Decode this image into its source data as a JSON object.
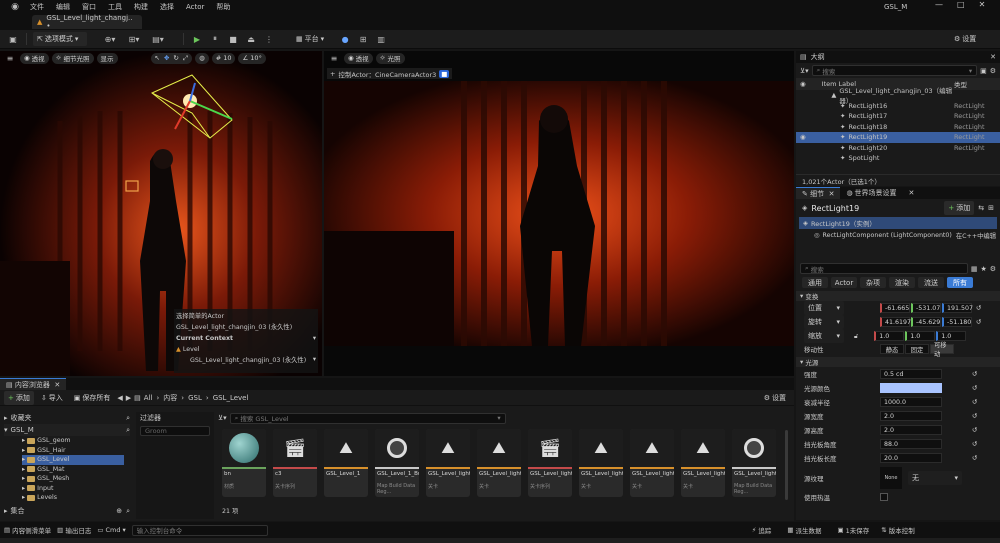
{
  "menu": {
    "file": "文件",
    "edit": "编辑",
    "window": "窗口",
    "tools": "工具",
    "build": "构建",
    "select": "选择",
    "actor": "Actor",
    "help": "帮助"
  },
  "window_title": "GSL_M",
  "doc_tab": "GSL_Level_light_changj.. •",
  "toolbar": {
    "mode": "选项模式",
    "platform": "平台",
    "settings": "设置"
  },
  "viewport_left": {
    "perspective": "透视",
    "lighting": "细节光照",
    "show": "显示",
    "grid": "10",
    "angle": "10°",
    "overlay_title": "选择简单的Actor",
    "overlay_actor": "GSL_Level_light_changjin_03 (永久性)",
    "current_context": "Current Context",
    "level_label": "Level",
    "level_value": "GSL_Level_light_changjin_03 (永久性)"
  },
  "viewport_right": {
    "perspective": "透视",
    "lighting": "光照",
    "pilot": "控制Actor：CineCameraActor3"
  },
  "outliner": {
    "title": "大纲",
    "search": "搜索",
    "col_label": "Item Label",
    "col_type": "类型",
    "rows": [
      {
        "label": "GSL_Level_light_changjin_03（编辑器）",
        "type": "",
        "indent": 1,
        "selected": false
      },
      {
        "label": "RectLight16",
        "type": "RectLight",
        "indent": 2,
        "selected": false
      },
      {
        "label": "RectLight17",
        "type": "RectLight",
        "indent": 2,
        "selected": false
      },
      {
        "label": "RectLight18",
        "type": "RectLight",
        "indent": 2,
        "selected": false
      },
      {
        "label": "RectLight19",
        "type": "RectLight",
        "indent": 2,
        "selected": true
      },
      {
        "label": "RectLight20",
        "type": "RectLight",
        "indent": 2,
        "selected": false
      },
      {
        "label": "SpotLight",
        "type": "",
        "indent": 2,
        "selected": false
      }
    ],
    "status": "1,021个Actor（已选1个）"
  },
  "details": {
    "tab_details": "细节",
    "tab_world": "世界场景设置",
    "object_name": "RectLight19",
    "add": "添加",
    "instance": "RectLight19（实例）",
    "component": "RectLightComponent (LightComponent0)",
    "edit_cpp": "在C++中编辑",
    "search": "搜索",
    "filters": [
      "通用",
      "Actor",
      "杂项",
      "渲染",
      "流送",
      "所有"
    ],
    "transform_section": "变换",
    "location_label": "位置",
    "location": [
      "-61.665",
      "-531.07",
      "191.507"
    ],
    "rotation_label": "旋转",
    "rotation": [
      "41.6197",
      "-45.629",
      "-51.180"
    ],
    "scale_label": "缩放",
    "scale": [
      "1.0",
      "1.0",
      "1.0"
    ],
    "mobility_label": "移动性",
    "mobility": [
      "静态",
      "固定",
      "可移动"
    ],
    "light_section": "光源",
    "props": [
      {
        "label": "强度",
        "value": "0.5 cd"
      },
      {
        "label": "光源颜色",
        "value": ""
      },
      {
        "label": "衰减半径",
        "value": "1000.0"
      },
      {
        "label": "源宽度",
        "value": "2.0"
      },
      {
        "label": "源高度",
        "value": "2.0"
      },
      {
        "label": "挡光板角度",
        "value": "88.0"
      },
      {
        "label": "挡光板长度",
        "value": "20.0"
      }
    ],
    "texture_label": "源纹理",
    "texture_thumb": "None",
    "texture_value": "无",
    "shadow_label": "使用热温"
  },
  "colors": {
    "selection": "#3a5fa0",
    "accent": "#3a7bd5",
    "light_color": "#a9c4ff"
  },
  "content_browser": {
    "tab": "内容浏览器",
    "add": "添加",
    "import": "导入",
    "save_all": "保存所有",
    "breadcrumb": [
      "All",
      "内容",
      "GSL",
      "GSL_Level"
    ],
    "settings": "设置",
    "favorites": "收藏夹",
    "root": "GSL_M",
    "folders": [
      "GSL_geom",
      "GSL_Hair",
      "GSL_Level",
      "GSL_Mat",
      "GSL_Mesh",
      "Input",
      "Levels"
    ],
    "selected_folder": "GSL_Level",
    "collections": "集合",
    "filter_label": "过滤器",
    "filter_chip": "Groom",
    "search": "搜索 GSL_Level",
    "assets": [
      {
        "name": "bn",
        "type": "材质",
        "kind": "sphere",
        "color": "#6aa35c"
      },
      {
        "name": "c3",
        "type": "关卡序列",
        "kind": "clap",
        "color": "#c44a4a"
      },
      {
        "name": "GSL_Level_1",
        "type": "",
        "kind": "mount",
        "color": "#d7902b"
      },
      {
        "name": "GSL_Level_1_BuiltData",
        "type": "Map Build Data Reg...",
        "kind": "cube",
        "color": "#c8c8c8"
      },
      {
        "name": "GSL_Level_light",
        "type": "关卡",
        "kind": "mount",
        "color": "#d7902b"
      },
      {
        "name": "GSL_Level_light2",
        "type": "关卡",
        "kind": "mount",
        "color": "#d7902b"
      },
      {
        "name": "GSL_Level_light_sp",
        "type": "关卡序列",
        "kind": "clap",
        "color": "#c44a4a"
      },
      {
        "name": "GSL_Level_light_changj..",
        "type": "关卡",
        "kind": "mount",
        "color": "#d7902b"
      },
      {
        "name": "GSL_Level_light_changj..",
        "type": "关卡",
        "kind": "mount",
        "color": "#d7902b"
      },
      {
        "name": "GSL_Level_light_changj..",
        "type": "关卡",
        "kind": "mount",
        "color": "#d7902b"
      },
      {
        "name": "GSL_Level_light_changj..",
        "type": "Map Build Data Reg...",
        "kind": "cube",
        "color": "#c8c8c8"
      }
    ],
    "count": "21 项"
  },
  "statusbar": {
    "drawer": "内容侧滑菜单",
    "output": "输出日志",
    "cmd": "Cmd",
    "cmd_placeholder": "输入控制台命令",
    "trace": "追踪",
    "derived": "派生数据",
    "save": "1未保存",
    "source": "版本控制"
  }
}
